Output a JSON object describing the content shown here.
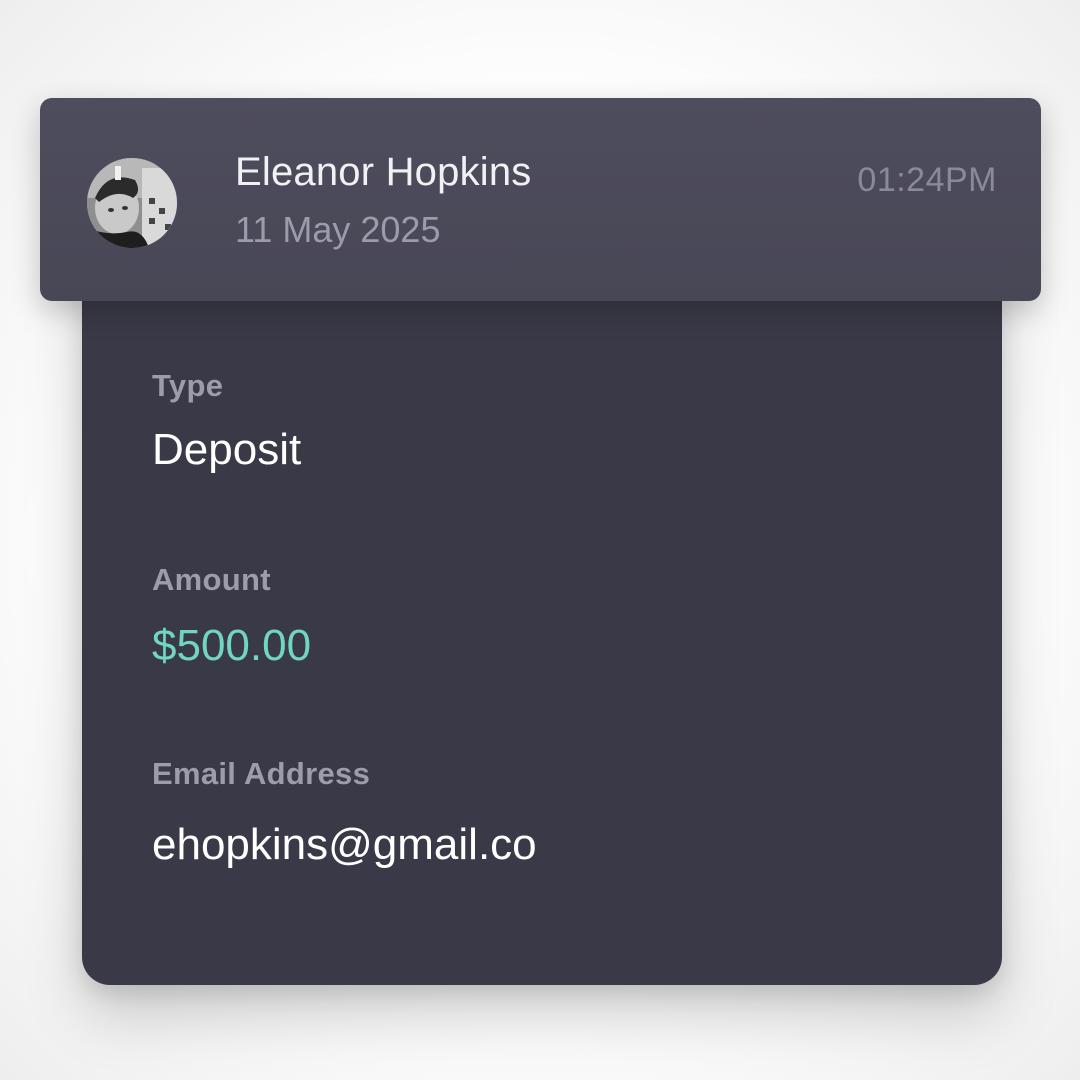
{
  "transaction": {
    "name": "Eleanor Hopkins",
    "date": "11 May 2025",
    "time": "01:24PM",
    "avatar_icon": "user-photo-avatar",
    "fields": [
      {
        "label": "Type",
        "value": "Deposit"
      },
      {
        "label": "Amount",
        "value": "$500.00"
      },
      {
        "label": "Email Address",
        "value": "ehopkins@gmail.co"
      }
    ]
  },
  "colors": {
    "header_bg": "#4e4d5d",
    "card_bg": "#3a3947",
    "label": "#9d9cab",
    "value": "#ffffff",
    "amount": "#71d6c1"
  }
}
